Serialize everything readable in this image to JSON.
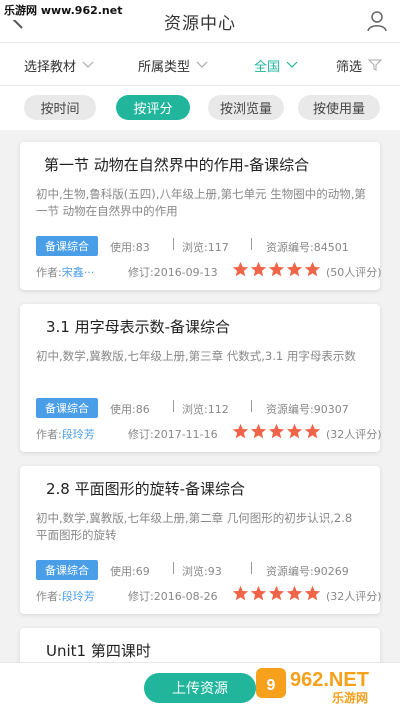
{
  "watermark": "乐游网 www.962.net",
  "header": {
    "title": "资源中心"
  },
  "filters": [
    {
      "label": "选择教材",
      "active": false
    },
    {
      "label": "所属类型",
      "active": false
    },
    {
      "label": "全国",
      "active": true
    },
    {
      "label": "筛选",
      "active": false
    }
  ],
  "sort": [
    {
      "label": "按时间",
      "active": false
    },
    {
      "label": "按评分",
      "active": true
    },
    {
      "label": "按浏览量",
      "active": false
    },
    {
      "label": "按使用量",
      "active": false
    }
  ],
  "cards": [
    {
      "title": "第一节  动物在自然界中的作用-备课综合",
      "desc": "初中,生物,鲁科版(五四),八年级上册,第七单元  生物圈中的动物,第一节  动物在自然界中的作用",
      "badge": "备课综合",
      "uses": "使用:83",
      "views": "浏览:117",
      "resource_id": "资源编号:84501",
      "author_label": "作者:",
      "author": "宋鑫···",
      "revised": "修订:2016-09-13",
      "rating": 5,
      "rating_count": "(50人评分)"
    },
    {
      "title": "3.1 用字母表示数-备课综合",
      "desc": "初中,数学,冀教版,七年级上册,第三章 代数式,3.1 用字母表示数",
      "badge": "备课综合",
      "uses": "使用:86",
      "views": "浏览:112",
      "resource_id": "资源编号:90307",
      "author_label": "作者:",
      "author": "段玲芳",
      "revised": "修订:2017-11-16",
      "rating": 5,
      "rating_count": "(32人评分)"
    },
    {
      "title": "2.8 平面图形的旋转-备课综合",
      "desc": "初中,数学,冀教版,七年级上册,第二章 几何图形的初步认识,2.8 平面图形的旋转",
      "badge": "备课综合",
      "uses": "使用:69",
      "views": "浏览:93",
      "resource_id": "资源编号:90269",
      "author_label": "作者:",
      "author": "段玲芳",
      "revised": "修订:2016-08-26",
      "rating": 5,
      "rating_count": "(32人评分)"
    },
    {
      "title": "Unit1 第四课时"
    }
  ],
  "upload_button": "上传资源",
  "watermark_logo": {
    "brand": "962.NET",
    "sub": "乐游网"
  },
  "colors": {
    "accent": "#21b59c",
    "badge": "#4a9ee8",
    "star": "#f0654a"
  }
}
